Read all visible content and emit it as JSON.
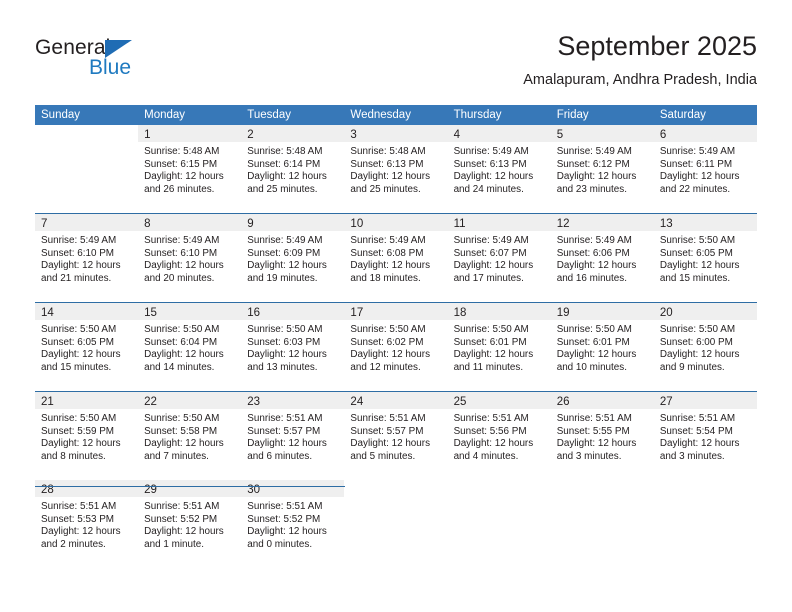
{
  "brand": {
    "name_top": "General",
    "name_bottom": "Blue",
    "triangle_color": "#1f6cb4",
    "text_color": "#231f20",
    "blue_text_color": "#1f7ac0"
  },
  "header": {
    "title": "September 2025",
    "subtitle": "Amalapuram, Andhra Pradesh, India"
  },
  "theme": {
    "header_row_bg": "#3778b8",
    "header_row_text": "#ffffff",
    "daynum_band_bg": "#efefef",
    "week_separator": "#2e6da4",
    "body_text": "#231f20"
  },
  "weekdays": [
    "Sunday",
    "Monday",
    "Tuesday",
    "Wednesday",
    "Thursday",
    "Friday",
    "Saturday"
  ],
  "weeks": [
    [
      {
        "day": "",
        "sunrise": "",
        "sunset": "",
        "daylight1": "",
        "daylight2": "",
        "empty": true
      },
      {
        "day": "1",
        "sunrise": "Sunrise: 5:48 AM",
        "sunset": "Sunset: 6:15 PM",
        "daylight1": "Daylight: 12 hours",
        "daylight2": "and 26 minutes."
      },
      {
        "day": "2",
        "sunrise": "Sunrise: 5:48 AM",
        "sunset": "Sunset: 6:14 PM",
        "daylight1": "Daylight: 12 hours",
        "daylight2": "and 25 minutes."
      },
      {
        "day": "3",
        "sunrise": "Sunrise: 5:48 AM",
        "sunset": "Sunset: 6:13 PM",
        "daylight1": "Daylight: 12 hours",
        "daylight2": "and 25 minutes."
      },
      {
        "day": "4",
        "sunrise": "Sunrise: 5:49 AM",
        "sunset": "Sunset: 6:13 PM",
        "daylight1": "Daylight: 12 hours",
        "daylight2": "and 24 minutes."
      },
      {
        "day": "5",
        "sunrise": "Sunrise: 5:49 AM",
        "sunset": "Sunset: 6:12 PM",
        "daylight1": "Daylight: 12 hours",
        "daylight2": "and 23 minutes."
      },
      {
        "day": "6",
        "sunrise": "Sunrise: 5:49 AM",
        "sunset": "Sunset: 6:11 PM",
        "daylight1": "Daylight: 12 hours",
        "daylight2": "and 22 minutes."
      }
    ],
    [
      {
        "day": "7",
        "sunrise": "Sunrise: 5:49 AM",
        "sunset": "Sunset: 6:10 PM",
        "daylight1": "Daylight: 12 hours",
        "daylight2": "and 21 minutes."
      },
      {
        "day": "8",
        "sunrise": "Sunrise: 5:49 AM",
        "sunset": "Sunset: 6:10 PM",
        "daylight1": "Daylight: 12 hours",
        "daylight2": "and 20 minutes."
      },
      {
        "day": "9",
        "sunrise": "Sunrise: 5:49 AM",
        "sunset": "Sunset: 6:09 PM",
        "daylight1": "Daylight: 12 hours",
        "daylight2": "and 19 minutes."
      },
      {
        "day": "10",
        "sunrise": "Sunrise: 5:49 AM",
        "sunset": "Sunset: 6:08 PM",
        "daylight1": "Daylight: 12 hours",
        "daylight2": "and 18 minutes."
      },
      {
        "day": "11",
        "sunrise": "Sunrise: 5:49 AM",
        "sunset": "Sunset: 6:07 PM",
        "daylight1": "Daylight: 12 hours",
        "daylight2": "and 17 minutes."
      },
      {
        "day": "12",
        "sunrise": "Sunrise: 5:49 AM",
        "sunset": "Sunset: 6:06 PM",
        "daylight1": "Daylight: 12 hours",
        "daylight2": "and 16 minutes."
      },
      {
        "day": "13",
        "sunrise": "Sunrise: 5:50 AM",
        "sunset": "Sunset: 6:05 PM",
        "daylight1": "Daylight: 12 hours",
        "daylight2": "and 15 minutes."
      }
    ],
    [
      {
        "day": "14",
        "sunrise": "Sunrise: 5:50 AM",
        "sunset": "Sunset: 6:05 PM",
        "daylight1": "Daylight: 12 hours",
        "daylight2": "and 15 minutes."
      },
      {
        "day": "15",
        "sunrise": "Sunrise: 5:50 AM",
        "sunset": "Sunset: 6:04 PM",
        "daylight1": "Daylight: 12 hours",
        "daylight2": "and 14 minutes."
      },
      {
        "day": "16",
        "sunrise": "Sunrise: 5:50 AM",
        "sunset": "Sunset: 6:03 PM",
        "daylight1": "Daylight: 12 hours",
        "daylight2": "and 13 minutes."
      },
      {
        "day": "17",
        "sunrise": "Sunrise: 5:50 AM",
        "sunset": "Sunset: 6:02 PM",
        "daylight1": "Daylight: 12 hours",
        "daylight2": "and 12 minutes."
      },
      {
        "day": "18",
        "sunrise": "Sunrise: 5:50 AM",
        "sunset": "Sunset: 6:01 PM",
        "daylight1": "Daylight: 12 hours",
        "daylight2": "and 11 minutes."
      },
      {
        "day": "19",
        "sunrise": "Sunrise: 5:50 AM",
        "sunset": "Sunset: 6:01 PM",
        "daylight1": "Daylight: 12 hours",
        "daylight2": "and 10 minutes."
      },
      {
        "day": "20",
        "sunrise": "Sunrise: 5:50 AM",
        "sunset": "Sunset: 6:00 PM",
        "daylight1": "Daylight: 12 hours",
        "daylight2": "and 9 minutes."
      }
    ],
    [
      {
        "day": "21",
        "sunrise": "Sunrise: 5:50 AM",
        "sunset": "Sunset: 5:59 PM",
        "daylight1": "Daylight: 12 hours",
        "daylight2": "and 8 minutes."
      },
      {
        "day": "22",
        "sunrise": "Sunrise: 5:50 AM",
        "sunset": "Sunset: 5:58 PM",
        "daylight1": "Daylight: 12 hours",
        "daylight2": "and 7 minutes."
      },
      {
        "day": "23",
        "sunrise": "Sunrise: 5:51 AM",
        "sunset": "Sunset: 5:57 PM",
        "daylight1": "Daylight: 12 hours",
        "daylight2": "and 6 minutes."
      },
      {
        "day": "24",
        "sunrise": "Sunrise: 5:51 AM",
        "sunset": "Sunset: 5:57 PM",
        "daylight1": "Daylight: 12 hours",
        "daylight2": "and 5 minutes."
      },
      {
        "day": "25",
        "sunrise": "Sunrise: 5:51 AM",
        "sunset": "Sunset: 5:56 PM",
        "daylight1": "Daylight: 12 hours",
        "daylight2": "and 4 minutes."
      },
      {
        "day": "26",
        "sunrise": "Sunrise: 5:51 AM",
        "sunset": "Sunset: 5:55 PM",
        "daylight1": "Daylight: 12 hours",
        "daylight2": "and 3 minutes."
      },
      {
        "day": "27",
        "sunrise": "Sunrise: 5:51 AM",
        "sunset": "Sunset: 5:54 PM",
        "daylight1": "Daylight: 12 hours",
        "daylight2": "and 3 minutes."
      }
    ],
    [
      {
        "day": "28",
        "sunrise": "Sunrise: 5:51 AM",
        "sunset": "Sunset: 5:53 PM",
        "daylight1": "Daylight: 12 hours",
        "daylight2": "and 2 minutes."
      },
      {
        "day": "29",
        "sunrise": "Sunrise: 5:51 AM",
        "sunset": "Sunset: 5:52 PM",
        "daylight1": "Daylight: 12 hours",
        "daylight2": "and 1 minute."
      },
      {
        "day": "30",
        "sunrise": "Sunrise: 5:51 AM",
        "sunset": "Sunset: 5:52 PM",
        "daylight1": "Daylight: 12 hours",
        "daylight2": "and 0 minutes."
      },
      {
        "day": "",
        "sunrise": "",
        "sunset": "",
        "daylight1": "",
        "daylight2": "",
        "empty": true
      },
      {
        "day": "",
        "sunrise": "",
        "sunset": "",
        "daylight1": "",
        "daylight2": "",
        "empty": true
      },
      {
        "day": "",
        "sunrise": "",
        "sunset": "",
        "daylight1": "",
        "daylight2": "",
        "empty": true
      },
      {
        "day": "",
        "sunrise": "",
        "sunset": "",
        "daylight1": "",
        "daylight2": "",
        "empty": true
      }
    ]
  ]
}
